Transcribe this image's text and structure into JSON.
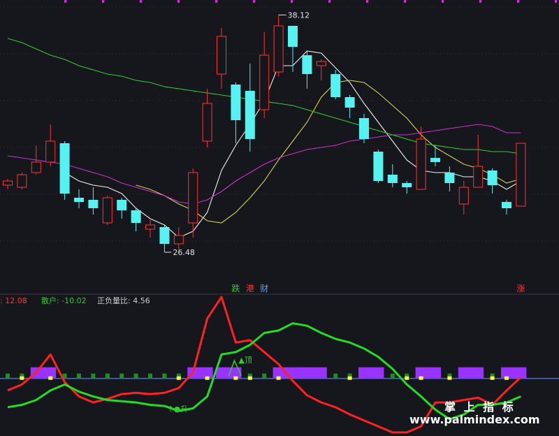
{
  "chart_data": [
    {
      "type": "candlestick",
      "title": "",
      "ylim": [
        25.5,
        38.5
      ],
      "high_label": "38.12",
      "low_label": "26.48",
      "candles": [
        {
          "o": 30.0,
          "c": 30.2,
          "h": 30.3,
          "l": 29.8
        },
        {
          "o": 29.9,
          "c": 30.5,
          "h": 30.6,
          "l": 29.8
        },
        {
          "o": 30.6,
          "c": 31.1,
          "h": 31.9,
          "l": 30.5
        },
        {
          "o": 31.1,
          "c": 32.1,
          "h": 32.9,
          "l": 30.9
        },
        {
          "o": 32.0,
          "c": 29.6,
          "h": 32.1,
          "l": 29.3
        },
        {
          "o": 29.4,
          "c": 29.2,
          "h": 29.8,
          "l": 28.9
        },
        {
          "o": 29.3,
          "c": 28.9,
          "h": 29.9,
          "l": 28.6
        },
        {
          "o": 28.2,
          "c": 29.4,
          "h": 29.5,
          "l": 28.1
        },
        {
          "o": 29.3,
          "c": 28.8,
          "h": 29.4,
          "l": 28.4
        },
        {
          "o": 28.8,
          "c": 28.2,
          "h": 28.9,
          "l": 27.8
        },
        {
          "o": 27.9,
          "c": 28.1,
          "h": 28.4,
          "l": 27.5
        },
        {
          "o": 28.0,
          "c": 27.2,
          "h": 28.1,
          "l": 26.8
        },
        {
          "o": 27.2,
          "c": 27.6,
          "h": 28.0,
          "l": 26.9
        },
        {
          "o": 28.2,
          "c": 30.6,
          "h": 30.8,
          "l": 27.5
        },
        {
          "o": 32.1,
          "c": 33.9,
          "h": 34.6,
          "l": 31.8
        },
        {
          "o": 35.3,
          "c": 37.1,
          "h": 37.5,
          "l": 34.6
        },
        {
          "o": 34.8,
          "c": 33.1,
          "h": 34.9,
          "l": 32.0
        },
        {
          "o": 34.5,
          "c": 32.2,
          "h": 35.8,
          "l": 31.6
        },
        {
          "o": 33.6,
          "c": 36.2,
          "h": 37.3,
          "l": 33.2
        },
        {
          "o": 35.4,
          "c": 37.6,
          "h": 38.12,
          "l": 35.2
        },
        {
          "o": 37.6,
          "c": 36.6,
          "h": 37.6,
          "l": 35.4
        },
        {
          "o": 36.2,
          "c": 35.3,
          "h": 36.4,
          "l": 34.6
        },
        {
          "o": 35.7,
          "c": 35.9,
          "h": 36.0,
          "l": 35.0
        },
        {
          "o": 35.3,
          "c": 34.2,
          "h": 35.5,
          "l": 34.1
        },
        {
          "o": 34.2,
          "c": 33.7,
          "h": 34.3,
          "l": 33.2
        },
        {
          "o": 33.2,
          "c": 32.2,
          "h": 33.4,
          "l": 32.0
        },
        {
          "o": 31.6,
          "c": 30.2,
          "h": 31.7,
          "l": 30.1
        },
        {
          "o": 30.5,
          "c": 30.1,
          "h": 31.0,
          "l": 29.9
        },
        {
          "o": 30.1,
          "c": 29.9,
          "h": 30.2,
          "l": 29.6
        },
        {
          "o": 29.8,
          "c": 32.2,
          "h": 32.8,
          "l": 29.8
        },
        {
          "o": 31.3,
          "c": 31.1,
          "h": 31.9,
          "l": 30.9
        },
        {
          "o": 30.6,
          "c": 30.1,
          "h": 30.9,
          "l": 29.7
        },
        {
          "o": 29.1,
          "c": 29.9,
          "h": 30.2,
          "l": 28.6
        },
        {
          "o": 29.9,
          "c": 30.9,
          "h": 32.4,
          "l": 29.9
        },
        {
          "o": 30.7,
          "c": 30.0,
          "h": 30.8,
          "l": 29.6
        },
        {
          "o": 29.2,
          "c": 28.9,
          "h": 29.3,
          "l": 28.6
        },
        {
          "o": 29.0,
          "c": 32.0,
          "h": 32.0,
          "l": 29.0
        }
      ],
      "series": [
        {
          "color": "#f0f0f0",
          "values": [
            null,
            null,
            null,
            null,
            30.6,
            30.2,
            30.0,
            29.9,
            29.6,
            28.9,
            28.4,
            28.1,
            27.5,
            27.8,
            28.7,
            30.7,
            31.9,
            32.9,
            34.0,
            35.7,
            35.7,
            36.4,
            36.3,
            35.6,
            34.9,
            33.9,
            33.0,
            32.1,
            31.2,
            30.7,
            30.6,
            30.6,
            30.4,
            30.4,
            30.2,
            29.8,
            30.2
          ]
        },
        {
          "color": "#d4d44a",
          "values": [
            null,
            null,
            null,
            null,
            null,
            null,
            null,
            null,
            null,
            30.0,
            29.8,
            29.5,
            29.1,
            28.8,
            28.3,
            28.2,
            28.7,
            29.4,
            30.2,
            31.2,
            32.1,
            33.0,
            34.2,
            34.9,
            35.0,
            34.9,
            34.4,
            33.8,
            33.2,
            32.4,
            31.8,
            31.4,
            31.0,
            30.8,
            30.5,
            30.1,
            30.3
          ]
        },
        {
          "color": "#cc33cc",
          "values": [
            31.4,
            31.3,
            31.2,
            31.1,
            31.0,
            30.8,
            30.6,
            30.4,
            30.1,
            29.9,
            29.7,
            29.5,
            29.2,
            29.1,
            29.3,
            29.7,
            30.2,
            30.6,
            31.0,
            31.3,
            31.5,
            31.7,
            31.8,
            31.9,
            32.1,
            32.2,
            32.3,
            32.4,
            32.4,
            32.5,
            32.6,
            32.7,
            32.8,
            32.9,
            32.8,
            32.5,
            32.5
          ]
        },
        {
          "color": "#33cc33",
          "values": [
            37.0,
            36.8,
            36.5,
            36.2,
            36.0,
            35.7,
            35.5,
            35.3,
            35.2,
            35.0,
            34.9,
            34.7,
            34.6,
            34.5,
            34.4,
            34.3,
            34.2,
            34.1,
            34.0,
            33.9,
            33.8,
            33.6,
            33.4,
            33.2,
            33.0,
            32.8,
            32.6,
            32.4,
            32.2,
            32.0,
            31.9,
            31.8,
            31.7,
            31.7,
            31.6,
            31.6,
            31.5
          ]
        }
      ],
      "markers": [
        {
          "index": 16,
          "text": "跌",
          "color": "#33cc33"
        },
        {
          "index": 17,
          "text": "港",
          "color": "#ff3333"
        },
        {
          "index": 18,
          "text": "财",
          "color": "#4da6ff"
        },
        {
          "index": 36,
          "text": "涨",
          "color": "#ff3333"
        }
      ]
    },
    {
      "type": "line",
      "title": "",
      "ylim": [
        -48,
        68
      ],
      "labels": [
        {
          "text": ": 12.08",
          "color": "#ff3333"
        },
        {
          "text": "散户: -10.02",
          "color": "#33cc33"
        },
        {
          "text": "正负量比: 4.56",
          "color": "#cccccc"
        }
      ],
      "series": [
        {
          "color": "#ff2222",
          "values": [
            -10,
            -5,
            5,
            20,
            -3,
            -15,
            -20,
            -17,
            -13,
            -12,
            -13,
            -12,
            -8,
            5,
            50,
            68,
            30,
            32,
            22,
            12,
            -2,
            -14,
            -20,
            -24,
            -30,
            -35,
            -40,
            -45,
            -45,
            -40,
            -20,
            -20,
            -18,
            -16,
            -22,
            -10,
            1
          ]
        },
        {
          "color": "#22dd22",
          "values": [
            -24,
            -22,
            -18,
            -10,
            -5,
            -11,
            -15,
            -18,
            -19,
            -20,
            -22,
            -23,
            -27,
            -25,
            -15,
            20,
            22,
            28,
            38,
            40,
            46,
            44,
            38,
            33,
            30,
            25,
            18,
            8,
            -5,
            -15,
            -26,
            -34,
            -30,
            -22,
            -22,
            -20,
            -15
          ]
        }
      ],
      "zero_blocks_purple": [
        [
          2,
          3
        ],
        [
          13,
          14
        ],
        [
          15,
          16
        ],
        [
          19,
          22
        ],
        [
          25,
          26
        ],
        [
          29,
          30
        ],
        [
          32,
          33
        ],
        [
          35,
          36
        ]
      ],
      "annotations": [
        {
          "index": 16,
          "text": "▲顶",
          "color": "#33cc33"
        },
        {
          "index": 11,
          "text": "↑●升",
          "color": "#33cc33"
        }
      ]
    }
  ],
  "watermark": {
    "line1": "掌 上 指 标",
    "line2": "www.palmindex.com"
  }
}
